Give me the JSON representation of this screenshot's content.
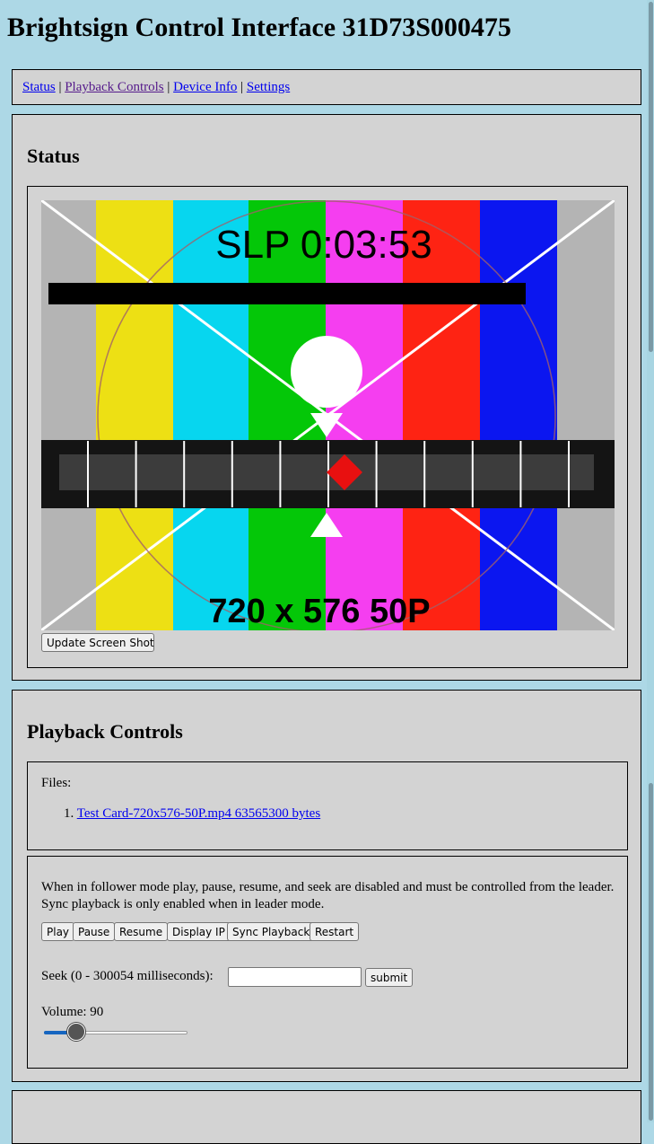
{
  "page_title": "Brightsign Control Interface 31D73S000475",
  "nav": {
    "links": [
      "Status",
      "Playback Controls",
      "Device Info",
      "Settings"
    ],
    "separator": "|"
  },
  "status": {
    "heading": "Status",
    "screenshot": {
      "top_text": "SLP 0:03:53",
      "bottom_text": "720 x 576 50P",
      "bar_colors": [
        "#b4b4b4",
        "#ede014",
        "#07d6ef",
        "#04c708",
        "#f53ef0",
        "#fe2313",
        "#0b16f0",
        "#b4b4b4"
      ]
    },
    "update_button": "Update Screen Shot"
  },
  "playback": {
    "heading": "Playback Controls",
    "files_label": "Files:",
    "files": [
      {
        "number": "1.",
        "name": "Test Card-720x576-50P.mp4 63565300 bytes"
      }
    ],
    "note": "When in follower mode play, pause, resume, and seek are disabled and must be controlled from the leader. Sync playback is only enabled when in leader mode.",
    "buttons": [
      "Play",
      "Pause",
      "Resume",
      "Display IP",
      "Sync Playback",
      "Restart"
    ],
    "seek_label": "Seek (0 - 300054 milliseconds):",
    "seek_value": "",
    "submit_label": "submit",
    "volume_label": "Volume: 90",
    "volume_fraction": 0.225
  },
  "colors": {
    "page_background": "#add8e6",
    "panel_background": "#d3d3d3",
    "link": "#0000ee",
    "visited_link": "#551a8b",
    "slider_fill": "#1565c0"
  },
  "scrollbar": {
    "thumb_ranges": [
      [
        0.0,
        0.315
      ],
      [
        0.696,
        1.0
      ]
    ]
  }
}
